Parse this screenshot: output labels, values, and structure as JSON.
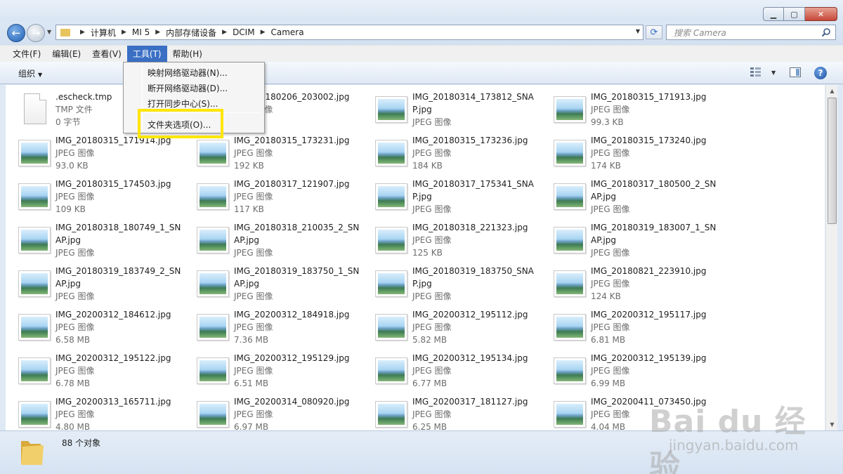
{
  "window": {
    "min_glyph": "▁",
    "max_glyph": "▢",
    "close_glyph": "✕"
  },
  "nav": {
    "breadcrumb": [
      "计算机",
      "MI 5",
      "内部存储设备",
      "DCIM",
      "Camera"
    ],
    "search_placeholder": "搜索 Camera"
  },
  "menubar": {
    "items": [
      "文件(F)",
      "编辑(E)",
      "查看(V)",
      "工具(T)",
      "帮助(H)"
    ],
    "active_index": 3
  },
  "toolbar": {
    "organize_label": "组织",
    "help_glyph": "?"
  },
  "tools_menu": {
    "items": [
      "映射网络驱动器(N)...",
      "断开网络驱动器(D)...",
      "打开同步中心(S)...",
      "文件夹选项(O)..."
    ],
    "highlighted_item": "文件夹选项(O)..."
  },
  "files": [
    {
      "name": ".escheck.tmp",
      "type": "TMP 文件",
      "size": "0 字节",
      "icon": "document-icon"
    },
    {
      "name": "IMG_20180206_203002.jpg",
      "type": "JPEG 图像",
      "size": "",
      "icon": "image-thumbnail"
    },
    {
      "name": "IMG_20180314_173812_SNAP.jpg",
      "type": "JPEG 图像",
      "size": "",
      "icon": "image-thumbnail"
    },
    {
      "name": "IMG_20180315_171913.jpg",
      "type": "JPEG 图像",
      "size": "99.3 KB",
      "icon": "image-thumbnail"
    },
    {
      "name": "IMG_20180315_171914.jpg",
      "type": "JPEG 图像",
      "size": "93.0 KB",
      "icon": "image-thumbnail"
    },
    {
      "name": "IMG_20180315_173231.jpg",
      "type": "JPEG 图像",
      "size": "192 KB",
      "icon": "image-thumbnail"
    },
    {
      "name": "IMG_20180315_173236.jpg",
      "type": "JPEG 图像",
      "size": "184 KB",
      "icon": "image-thumbnail"
    },
    {
      "name": "IMG_20180315_173240.jpg",
      "type": "JPEG 图像",
      "size": "174 KB",
      "icon": "image-thumbnail"
    },
    {
      "name": "IMG_20180315_174503.jpg",
      "type": "JPEG 图像",
      "size": "109 KB",
      "icon": "image-thumbnail"
    },
    {
      "name": "IMG_20180317_121907.jpg",
      "type": "JPEG 图像",
      "size": "117 KB",
      "icon": "image-thumbnail"
    },
    {
      "name": "IMG_20180317_175341_SNAP.jpg",
      "type": "JPEG 图像",
      "size": "",
      "icon": "image-thumbnail"
    },
    {
      "name": "IMG_20180317_180500_2_SNAP.jpg",
      "type": "JPEG 图像",
      "size": "",
      "icon": "image-thumbnail"
    },
    {
      "name": "IMG_20180318_180749_1_SNAP.jpg",
      "type": "JPEG 图像",
      "size": "",
      "icon": "image-thumbnail"
    },
    {
      "name": "IMG_20180318_210035_2_SNAP.jpg",
      "type": "JPEG 图像",
      "size": "",
      "icon": "image-thumbnail"
    },
    {
      "name": "IMG_20180318_221323.jpg",
      "type": "JPEG 图像",
      "size": "125 KB",
      "icon": "image-thumbnail"
    },
    {
      "name": "IMG_20180319_183007_1_SNAP.jpg",
      "type": "JPEG 图像",
      "size": "",
      "icon": "image-thumbnail"
    },
    {
      "name": "IMG_20180319_183749_2_SNAP.jpg",
      "type": "JPEG 图像",
      "size": "",
      "icon": "image-thumbnail"
    },
    {
      "name": "IMG_20180319_183750_1_SNAP.jpg",
      "type": "JPEG 图像",
      "size": "",
      "icon": "image-thumbnail"
    },
    {
      "name": "IMG_20180319_183750_SNAP.jpg",
      "type": "JPEG 图像",
      "size": "",
      "icon": "image-thumbnail"
    },
    {
      "name": "IMG_20180821_223910.jpg",
      "type": "JPEG 图像",
      "size": "124 KB",
      "icon": "image-thumbnail"
    },
    {
      "name": "IMG_20200312_184612.jpg",
      "type": "JPEG 图像",
      "size": "6.58 MB",
      "icon": "image-thumbnail"
    },
    {
      "name": "IMG_20200312_184918.jpg",
      "type": "JPEG 图像",
      "size": "7.36 MB",
      "icon": "image-thumbnail"
    },
    {
      "name": "IMG_20200312_195112.jpg",
      "type": "JPEG 图像",
      "size": "5.82 MB",
      "icon": "image-thumbnail"
    },
    {
      "name": "IMG_20200312_195117.jpg",
      "type": "JPEG 图像",
      "size": "6.81 MB",
      "icon": "image-thumbnail"
    },
    {
      "name": "IMG_20200312_195122.jpg",
      "type": "JPEG 图像",
      "size": "6.78 MB",
      "icon": "image-thumbnail"
    },
    {
      "name": "IMG_20200312_195129.jpg",
      "type": "JPEG 图像",
      "size": "6.51 MB",
      "icon": "image-thumbnail"
    },
    {
      "name": "IMG_20200312_195134.jpg",
      "type": "JPEG 图像",
      "size": "6.77 MB",
      "icon": "image-thumbnail"
    },
    {
      "name": "IMG_20200312_195139.jpg",
      "type": "JPEG 图像",
      "size": "6.99 MB",
      "icon": "image-thumbnail"
    },
    {
      "name": "IMG_20200313_165711.jpg",
      "type": "JPEG 图像",
      "size": "4.80 MB",
      "icon": "image-thumbnail"
    },
    {
      "name": "IMG_20200314_080920.jpg",
      "type": "JPEG 图像",
      "size": "6.97 MB",
      "icon": "image-thumbnail"
    },
    {
      "name": "IMG_20200317_181127.jpg",
      "type": "JPEG 图像",
      "size": "6.25 MB",
      "icon": "image-thumbnail"
    },
    {
      "name": "IMG_20200411_073450.jpg",
      "type": "JPEG 图像",
      "size": "4.04 MB",
      "icon": "image-thumbnail"
    }
  ],
  "status": {
    "count_label": "88 个对象"
  },
  "watermark": {
    "brand": "Bai du 经验",
    "url": "jingyan.baidu.com"
  },
  "colors": {
    "menu_active": "#3a6fc4",
    "highlight_box": "#ffe600",
    "window_bg": "#dfe9f5"
  }
}
